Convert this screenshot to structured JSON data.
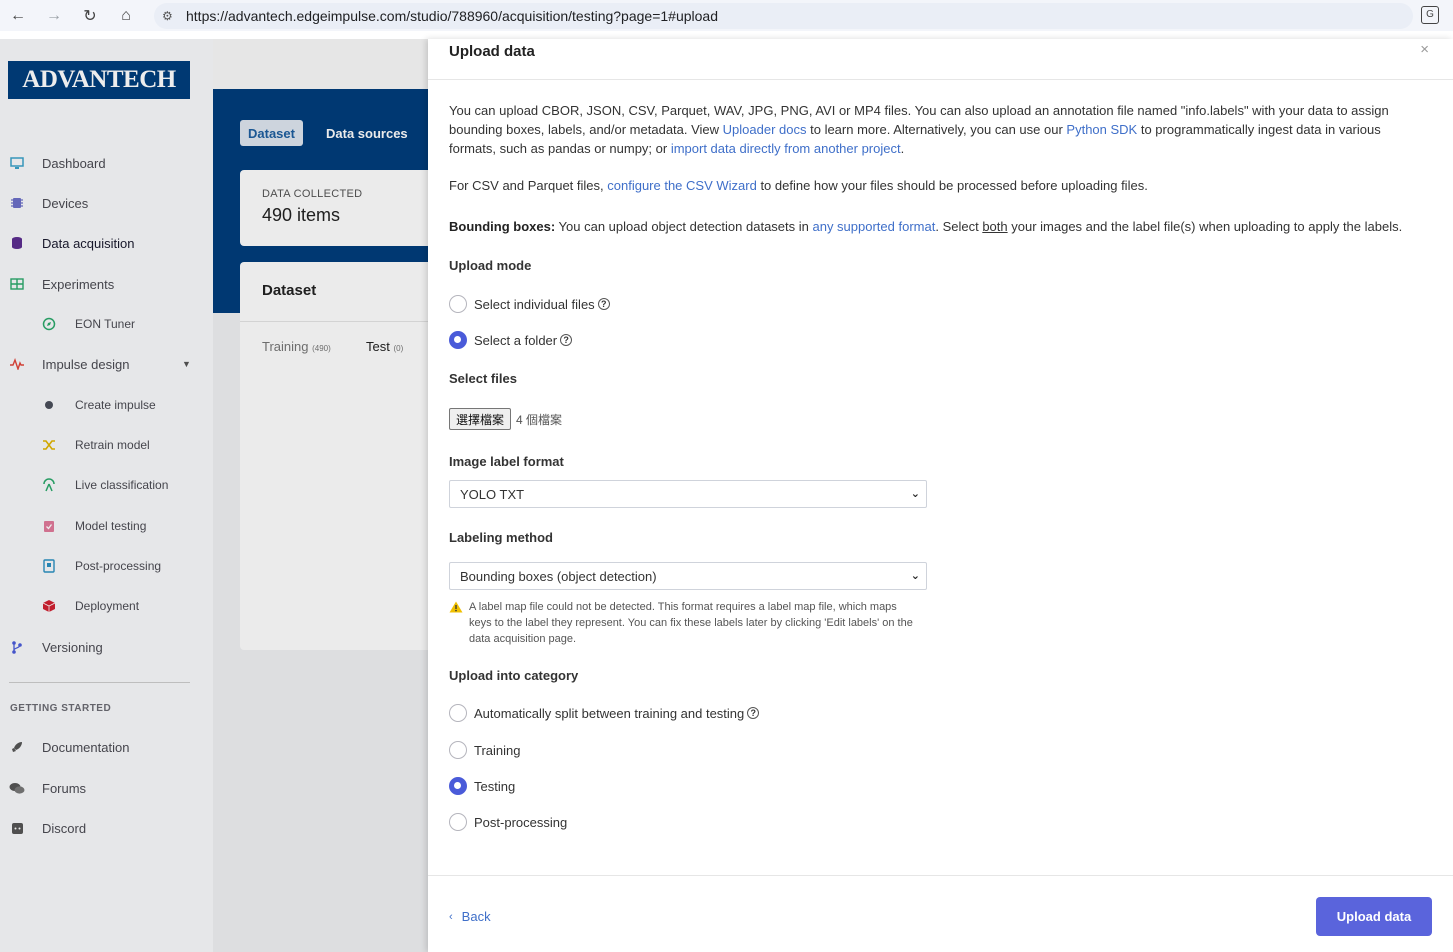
{
  "browser": {
    "url": "https://advantech.edgeimpulse.com/studio/788960/acquisition/testing?page=1#upload",
    "back_icon": "←",
    "forward_icon": "→",
    "reload_icon": "↻",
    "home_icon": "⌂",
    "site_icon": "⚙",
    "translate_icon": "G"
  },
  "sidebar": {
    "logo": "ADVANTECH",
    "items": [
      {
        "label": "Dashboard",
        "icon": "monitor-icon"
      },
      {
        "label": "Devices",
        "icon": "chip-icon"
      },
      {
        "label": "Data acquisition",
        "icon": "database-icon"
      },
      {
        "label": "Experiments",
        "icon": "grid-icon"
      },
      {
        "label": "EON Tuner",
        "icon": "compass-icon"
      },
      {
        "label": "Impulse design",
        "icon": "pulse-icon"
      },
      {
        "label": "Create impulse",
        "icon": "dot-icon"
      },
      {
        "label": "Retrain model",
        "icon": "shuffle-icon"
      },
      {
        "label": "Live classification",
        "icon": "antenna-icon"
      },
      {
        "label": "Model testing",
        "icon": "clipboard-check-icon"
      },
      {
        "label": "Post-processing",
        "icon": "report-icon"
      },
      {
        "label": "Deployment",
        "icon": "cube-icon"
      },
      {
        "label": "Versioning",
        "icon": "branch-icon"
      }
    ],
    "getting_started_heading": "GETTING STARTED",
    "getting_started": [
      {
        "label": "Documentation",
        "icon": "rocket-icon"
      },
      {
        "label": "Forums",
        "icon": "chat-icon"
      },
      {
        "label": "Discord",
        "icon": "discord-icon"
      }
    ]
  },
  "main": {
    "tabs": [
      {
        "label": "Dataset"
      },
      {
        "label": "Data sources"
      }
    ],
    "data_collected_label": "DATA COLLECTED",
    "data_collected_value": "490 items",
    "dataset_title": "Dataset",
    "training_tab": "Training",
    "training_count": "(490)",
    "test_tab": "Test",
    "test_count": "(0)"
  },
  "panel": {
    "title": "Upload data",
    "close_icon": "×",
    "intro": {
      "p1": "You can upload CBOR, JSON, CSV, Parquet, WAV, JPG, PNG, AVI or MP4 files. You can also upload an annotation file named \"info.labels\" with your data to assign",
      "p2a": "bounding boxes, labels, and/or metadata. View ",
      "p2_link1": "Uploader docs",
      "p2b": " to learn more. Alternatively, you can use our ",
      "p2_link2": "Python SDK",
      "p2c": " to programmatically ingest data in various",
      "p3a": "formats, such as pandas or numpy; or ",
      "p3_link": "import data directly from another project",
      "p3b": "."
    },
    "csv": {
      "a": "For CSV and Parquet files, ",
      "link": "configure the CSV Wizard",
      "b": " to define how your files should be processed before uploading files."
    },
    "bbox": {
      "bold": "Bounding boxes:",
      "a": " You can upload object detection datasets in ",
      "link": "any supported format",
      "b": ". Select ",
      "u": "both",
      "c": " your images and the label file(s) when uploading to apply the labels."
    },
    "upload_mode_label": "Upload mode",
    "upload_mode_options": [
      "Select individual files",
      "Select a folder"
    ],
    "upload_mode_selected": 1,
    "select_files_label": "Select files",
    "choose_button": "選擇檔案",
    "file_count": "4 個檔案",
    "image_label_format_label": "Image label format",
    "image_label_format_value": "YOLO TXT",
    "labeling_method_label": "Labeling method",
    "labeling_method_value": "Bounding boxes (object detection)",
    "warning_icon": "warning-icon",
    "warning_text_1": "A label map file could not be detected. This format requires a label map file, which maps",
    "warning_text_2": "keys to the label they represent. You can fix these labels later by clicking 'Edit labels' on the",
    "warning_text_3": "data acquisition page.",
    "category_label": "Upload into category",
    "category_options": [
      "Automatically split between training and testing",
      "Training",
      "Testing",
      "Post-processing"
    ],
    "category_selected": 2,
    "help_glyph": "?",
    "back_label": "Back",
    "back_icon": "‹",
    "upload_button": "Upload data"
  },
  "colors": {
    "brand": "#003d7c",
    "accent": "#5a64dc",
    "link": "#3f6fc9"
  }
}
